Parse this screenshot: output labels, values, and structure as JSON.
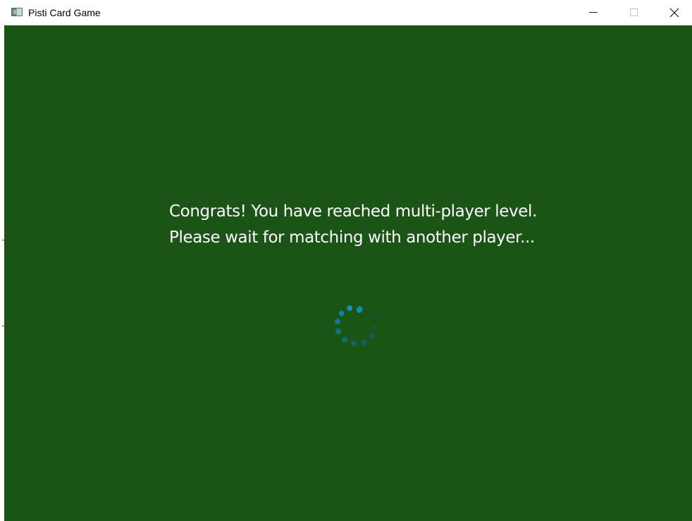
{
  "window": {
    "title": "Pisti Card Game",
    "controls": {
      "minimize": "minimize",
      "maximize": "maximize",
      "close": "close"
    }
  },
  "message": {
    "line1": "Congrats! You have reached multi-player level.",
    "line2": "Please wait for matching with another player..."
  },
  "spinner": {
    "state": "loading",
    "color": "#0e9ad2"
  },
  "colors": {
    "background": "#1b5516",
    "text": "#ffffff",
    "titlebar": "#ffffff"
  }
}
